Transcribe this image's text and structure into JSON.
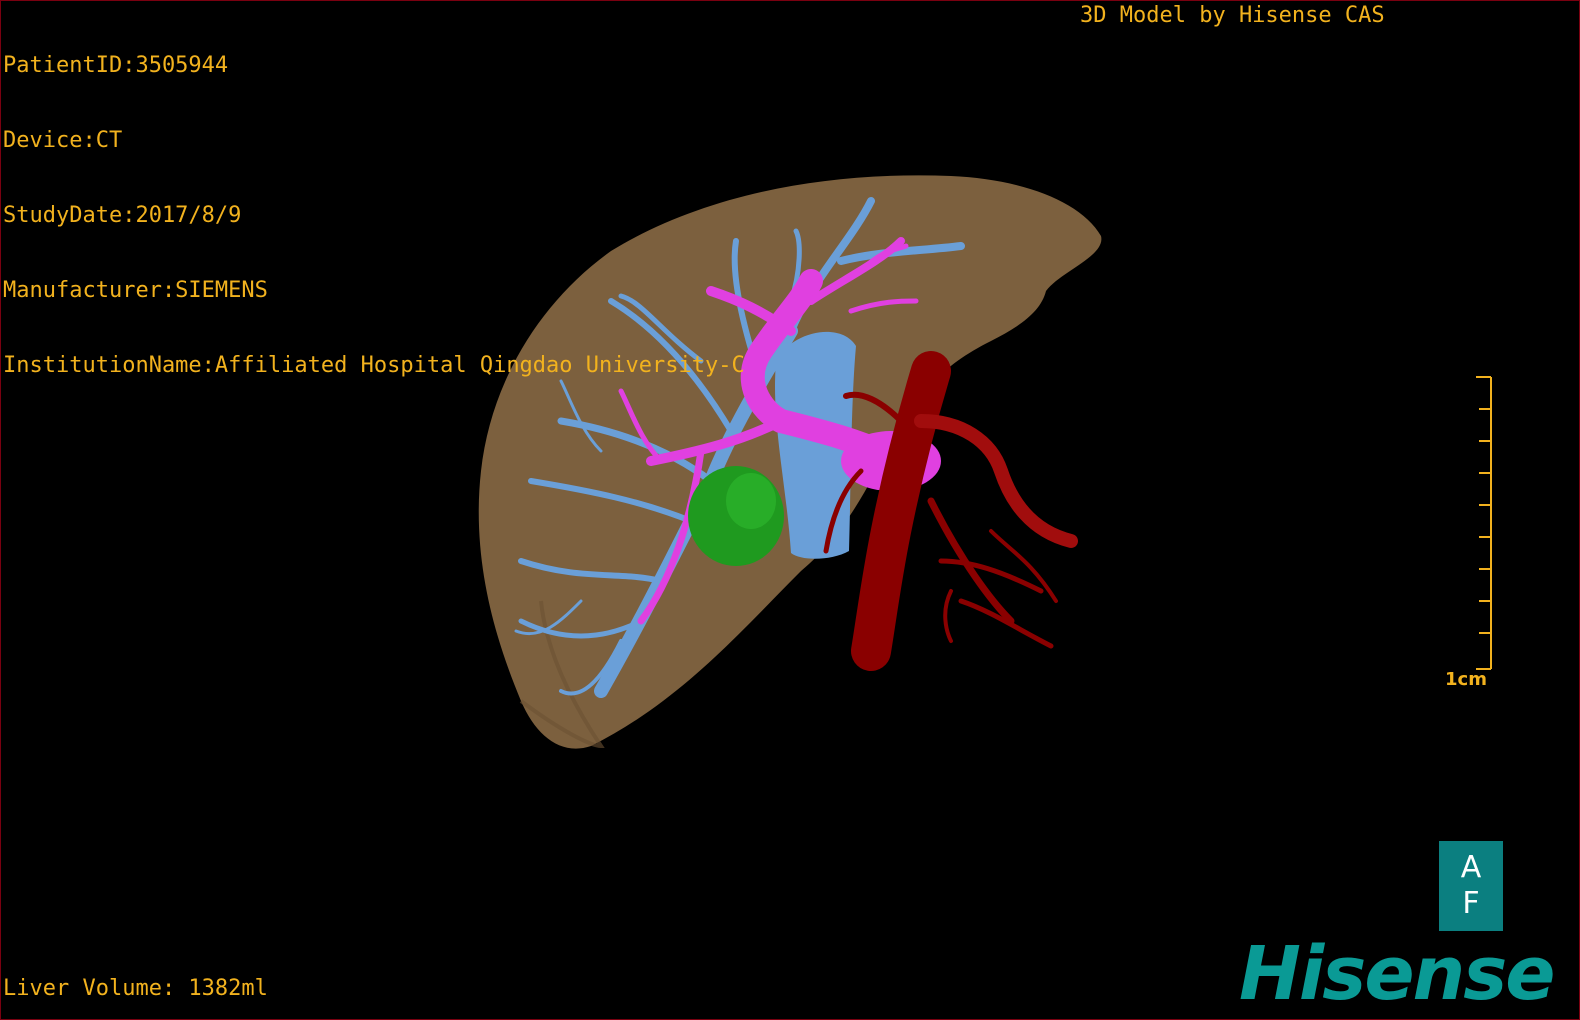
{
  "overlay": {
    "patient_id": "PatientID:3505944",
    "device": "Device:CT",
    "study_date": "StudyDate:2017/8/9",
    "manufacturer": "Manufacturer:SIEMENS",
    "institution": "InstitutionName:Affiliated Hospital Qingdao University-C",
    "credit": "3D Model by Hisense CAS",
    "liver_volume": "Liver Volume: 1382ml"
  },
  "scale": {
    "label": "1cm"
  },
  "orientation": {
    "top": "A",
    "bottom": "F"
  },
  "brand": {
    "logo": "Hisense"
  },
  "colors": {
    "overlay_text": "#f2b21e",
    "liver": "#8a6a45",
    "hepatic_vein": "#6a9fd8",
    "portal_vein": "#e040e0",
    "artery": "#8a0000",
    "lesion": "#1f9a1f",
    "brand": "#0a9a95"
  }
}
